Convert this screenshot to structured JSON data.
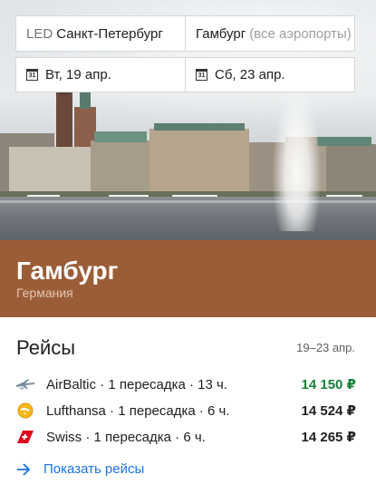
{
  "search": {
    "origin_code": "LED",
    "origin_city": "Санкт-Петербург",
    "destination_city": "Гамбург",
    "destination_hint": "(все аэропорты)",
    "depart_date": "Вт, 19 апр.",
    "return_date": "Сб, 23 апр.",
    "calendar_icon_text": "31"
  },
  "destination": {
    "city": "Гамбург",
    "country": "Германия",
    "band_color": "#9b5d37"
  },
  "flights": {
    "title": "Рейсы",
    "dates": "19–23 апр.",
    "items": [
      {
        "airline": "AirBaltic",
        "details": " · 1 пересадка · 13 ч.",
        "price": "14 150 ₽",
        "best": true,
        "icon": "airbaltic-logo-icon"
      },
      {
        "airline": "Lufthansa",
        "details": " · 1 пересадка · 6 ч.",
        "price": "14 524 ₽",
        "best": false,
        "icon": "lufthansa-logo-icon"
      },
      {
        "airline": "Swiss",
        "details": " · 1 пересадка · 6 ч.",
        "price": "14 265 ₽",
        "best": false,
        "icon": "swiss-logo-icon"
      }
    ],
    "show_link": "Показать рейсы",
    "best_price_color": "#188038",
    "link_color": "#1a73e8"
  }
}
